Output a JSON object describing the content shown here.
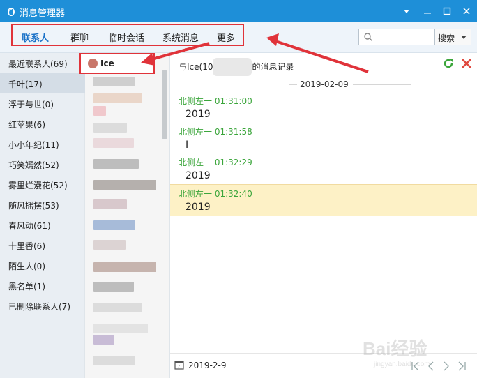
{
  "window": {
    "title": "消息管理器"
  },
  "toolbar": {
    "tabs": [
      {
        "label": "联系人",
        "active": true
      },
      {
        "label": "群聊"
      },
      {
        "label": "临时会话"
      },
      {
        "label": "系统消息"
      },
      {
        "label": "更多"
      }
    ],
    "search_placeholder": "",
    "search_button": "搜索"
  },
  "groups": [
    {
      "label": "最近联系人(69)"
    },
    {
      "label": "千叶(17)",
      "selected": true
    },
    {
      "label": "浮于与世(0)"
    },
    {
      "label": "红苹果(6)"
    },
    {
      "label": "小小年纪(11)"
    },
    {
      "label": "巧笑嫣然(52)"
    },
    {
      "label": "雾里烂漫花(52)"
    },
    {
      "label": "随风摇摆(53)"
    },
    {
      "label": "春风动(61)"
    },
    {
      "label": "十里香(6)"
    },
    {
      "label": "陌生人(0)"
    },
    {
      "label": "黑名单(1)"
    },
    {
      "label": "已删除联系人(7)"
    }
  ],
  "selected_contact": {
    "name": "Ice"
  },
  "content": {
    "title_prefix": "与Ice(10",
    "title_suffix": "的消息记录",
    "date_separator": "2019-02-09",
    "messages": [
      {
        "meta": "北侧左一 01:31:00",
        "text": "2019"
      },
      {
        "meta": "北侧左一 01:31:58",
        "text": "I"
      },
      {
        "meta": "北侧左一 01:32:29",
        "text": "2019"
      },
      {
        "meta": "北侧左一 01:32:40",
        "text": "2019",
        "highlighted": true
      }
    ],
    "footer_date": "2019-2-9"
  },
  "watermark": {
    "brand": "Bai经验",
    "url": "jingyan.baidu.com"
  },
  "colors": {
    "titlebar": "#1e8fd8",
    "highlight_box": "#e0333a",
    "sender": "#3aa53a",
    "active_tab": "#1d73c8"
  }
}
